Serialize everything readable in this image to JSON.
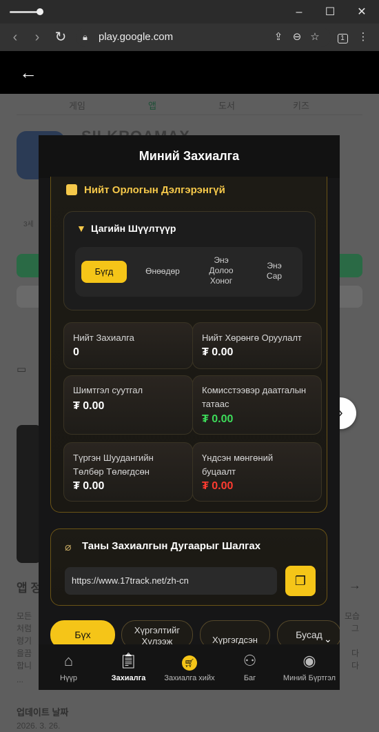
{
  "browser": {
    "url": "play.google.com",
    "tab_count": "1"
  },
  "store": {
    "tabs": [
      "게임",
      "앱",
      "도서",
      "키즈"
    ],
    "app_name": "SILKROAMAX",
    "age": "3세",
    "section_title": "앱 정",
    "description_lines": [
      "모든",
      "처럼",
      "령기",
      "을끔",
      "합니",
      "..."
    ],
    "description_right": [
      "모습",
      "그",
      "다",
      "다"
    ],
    "update_title": "업데이트 날짜",
    "update_date": "2026. 3. 26."
  },
  "modal": {
    "title": "Миний Захиалга",
    "summary": {
      "title": "Нийт Орлогын Дэлгэрэнгүй",
      "filter_title": "Цагийн Шүүлтүүр",
      "filter_options": [
        {
          "label": "Бүгд",
          "selected": true
        },
        {
          "label": "Өнөөдөр",
          "selected": false
        },
        {
          "label": "Энэ\nДолоо\nХоног",
          "selected": false
        },
        {
          "label": "Энэ\nСар",
          "selected": false
        }
      ],
      "stats": [
        {
          "label": "Нийт Захиалга",
          "value": "0",
          "color": "#ffffff"
        },
        {
          "label": "Нийт Хөрөнгө Оруулалт",
          "value": "₮ 0.00",
          "color": "#ffffff"
        },
        {
          "label": "Шимтгэл суутгал",
          "value": "₮ 0.00",
          "color": "#ffffff"
        },
        {
          "label": "Комисстээвэр даатгалын татаас",
          "value": "₮ 0.00",
          "color": "#3ddc5a"
        },
        {
          "label": "Түргэн Шуудангийн Төлбөр Төлөгдсөн",
          "value": "₮ 0.00",
          "color": "#ffffff"
        },
        {
          "label": "Үндсэн мөнгөний буцаалт",
          "value": "₮ 0.00",
          "color": "#ff3b30"
        }
      ]
    },
    "tracking": {
      "title": "Таны Захиалгын Дугаарыг Шалгах",
      "url": "https://www.17track.net/zh-cn"
    },
    "order_tabs": [
      {
        "label": "Бүх",
        "selected": true
      },
      {
        "label": "Хүргэлтийг Хүлээж",
        "selected": false
      },
      {
        "label": "Хүргэгдсэн",
        "selected": false
      },
      {
        "label": "Бусад",
        "selected": false
      }
    ],
    "bottom_nav": [
      {
        "label": "Нүүр",
        "icon": "home-icon",
        "active": false
      },
      {
        "label": "Захиалга",
        "icon": "clipboard-icon",
        "active": true
      },
      {
        "label": "Захиалга хийх",
        "icon": "cart-icon",
        "active": false
      },
      {
        "label": "Баг",
        "icon": "team-icon",
        "active": false
      },
      {
        "label": "Миний Бүртгэл",
        "icon": "profile-icon",
        "active": false
      }
    ]
  },
  "colors": {
    "accent": "#f5c518",
    "gold_text": "#f5c84a",
    "positive": "#3ddc5a",
    "negative": "#ff3b30"
  }
}
